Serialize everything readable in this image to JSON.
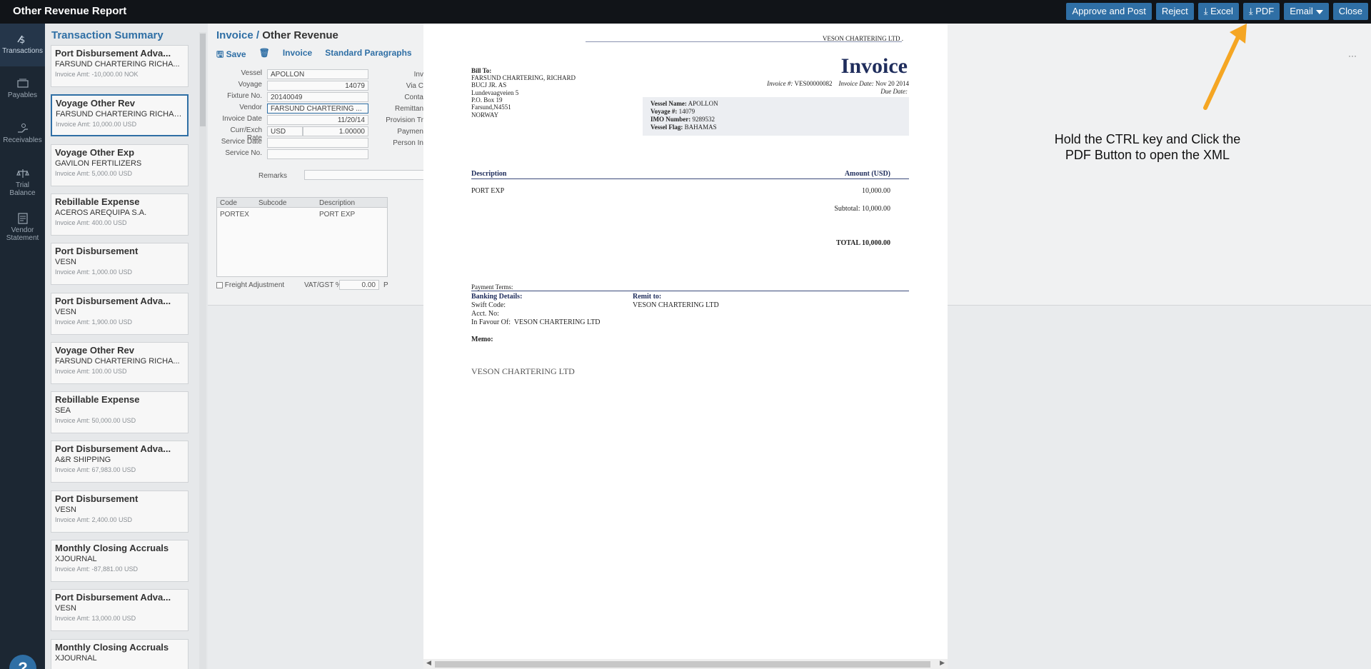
{
  "header": {
    "title": "Other Revenue Report",
    "buttons": {
      "approve": "Approve and Post",
      "reject": "Reject",
      "excel": "Excel",
      "pdf": "PDF",
      "email": "Email",
      "close": "Close"
    }
  },
  "leftnav": {
    "items": [
      {
        "label": "Transactions",
        "icon": "transactions-icon"
      },
      {
        "label": "Payables",
        "icon": "payables-icon"
      },
      {
        "label": "Receivables",
        "icon": "receivables-icon"
      },
      {
        "label": "Trial Balance",
        "icon": "trial-balance-icon"
      },
      {
        "label": "Vendor Statement",
        "icon": "vendor-statement-icon"
      }
    ],
    "help": "?"
  },
  "summary": {
    "title": "Transaction Summary",
    "cards": [
      {
        "title": "Port Disbursement Adva...",
        "sub": "FARSUND CHARTERING RICHA...",
        "amt": "Invoice Amt: -10,000.00 NOK"
      },
      {
        "title": "Voyage Other Rev",
        "sub": "FARSUND CHARTERING RICHAR...",
        "amt": "Invoice Amt: 10,000.00 USD"
      },
      {
        "title": "Voyage Other Exp",
        "sub": "GAVILON FERTILIZERS",
        "amt": "Invoice Amt: 5,000.00 USD"
      },
      {
        "title": "Rebillable Expense",
        "sub": "ACEROS AREQUIPA S.A.",
        "amt": "Invoice Amt: 400.00 USD"
      },
      {
        "title": "Port Disbursement",
        "sub": "VESN",
        "amt": "Invoice Amt: 1,000.00 USD"
      },
      {
        "title": "Port Disbursement Adva...",
        "sub": "VESN",
        "amt": "Invoice Amt: 1,900.00 USD"
      },
      {
        "title": "Voyage Other Rev",
        "sub": "FARSUND CHARTERING RICHA...",
        "amt": "Invoice Amt: 100.00 USD"
      },
      {
        "title": "Rebillable Expense",
        "sub": "SEA",
        "amt": "Invoice Amt: 50,000.00 USD"
      },
      {
        "title": "Port Disbursement Adva...",
        "sub": "A&R SHIPPING",
        "amt": "Invoice Amt: 67,983.00 USD"
      },
      {
        "title": "Port Disbursement",
        "sub": "VESN",
        "amt": "Invoice Amt: 2,400.00 USD"
      },
      {
        "title": "Monthly Closing Accruals",
        "sub": "XJOURNAL",
        "amt": "Invoice Amt: -87,881.00 USD"
      },
      {
        "title": "Port Disbursement Adva...",
        "sub": "VESN",
        "amt": "Invoice Amt: 13,000.00 USD"
      },
      {
        "title": "Monthly Closing Accruals",
        "sub": "XJOURNAL",
        "amt": ""
      }
    ]
  },
  "form": {
    "breadcrumb_link": "Invoice /",
    "breadcrumb_current": "Other Revenue",
    "toolbar": {
      "save": "Save",
      "invoice": "Invoice",
      "paragraphs": "Standard Paragraphs"
    },
    "fields": [
      {
        "label": "Vessel",
        "value": "APOLLON"
      },
      {
        "label": "Voyage",
        "value": "14079"
      },
      {
        "label": "Fixture No.",
        "value": "20140049"
      },
      {
        "label": "Vendor",
        "value": "FARSUND CHARTERING ..."
      },
      {
        "label": "Invoice Date",
        "value": "11/20/14"
      },
      {
        "label": "Curr/Exch Rate",
        "value": "USD"
      },
      {
        "label": "Service Date",
        "value": ""
      },
      {
        "label": "Service No.",
        "value": ""
      }
    ],
    "exch_rate": "1.00000",
    "right_labels": [
      "Inv",
      "Via C",
      "Conta",
      "Remittan",
      "Provision Tr",
      "Paymen",
      "Person In"
    ],
    "remarks_label": "Remarks",
    "grid_headers": {
      "code": "Code",
      "subcode": "Subcode",
      "description": "Description"
    },
    "grid_row": {
      "code": "PORTEX",
      "description": "PORT EXP"
    },
    "freight_adjustment": "Freight Adjustment",
    "vat_label": "VAT/GST %",
    "vat_value": "0.00",
    "vat_trailing": "P"
  },
  "pdf": {
    "company_header": "VESON CHARTERING LTD .",
    "heading": "Invoice",
    "bill_to_label": "Bill To:",
    "bill_to_lines": [
      "FARSUND CHARTERING, RICHARD",
      "BUCJ JR. AS",
      "Lundevaagveien 5",
      "P.O. Box 19",
      "Farsund,N4551",
      "NORWAY"
    ],
    "invoice_no_label": "Invoice #:",
    "invoice_no": "VES00000082",
    "invoice_date_label": "Invoice Date:",
    "invoice_date": "Nov 20 2014",
    "due_date_label": "Due Date:",
    "vessel_name_label": "Vessel Name:",
    "vessel_name": "APOLLON",
    "voyage_label": "Voyage #:",
    "voyage": "14079",
    "imo_label": "IMO Number:",
    "imo": "9289532",
    "flag_label": "Vessel Flag:",
    "flag": "BAHAMAS",
    "desc_header": "Description",
    "amount_header": "Amount (USD)",
    "line_desc": "PORT EXP",
    "line_amount": "10,000.00",
    "subtotal_label": "Subtotal:",
    "subtotal": "10,000.00",
    "total_label": "TOTAL",
    "total": "10,000.00",
    "payment_terms": "Payment Terms:",
    "banking_label": "Banking Details:",
    "swift": "Swift Code:",
    "acct": "Acct. No:",
    "favour_label": "In Favour Of:",
    "favour": "VESON CHARTERING LTD",
    "remit_label": "Remit to:",
    "remit": "VESON CHARTERING LTD",
    "memo": "Memo:",
    "footer": "VESON CHARTERING LTD"
  },
  "annotation": {
    "line1": "Hold the CTRL key and Click the",
    "line2": "PDF Button to open the XML",
    "color": "#f5a623"
  },
  "more_menu": "···"
}
